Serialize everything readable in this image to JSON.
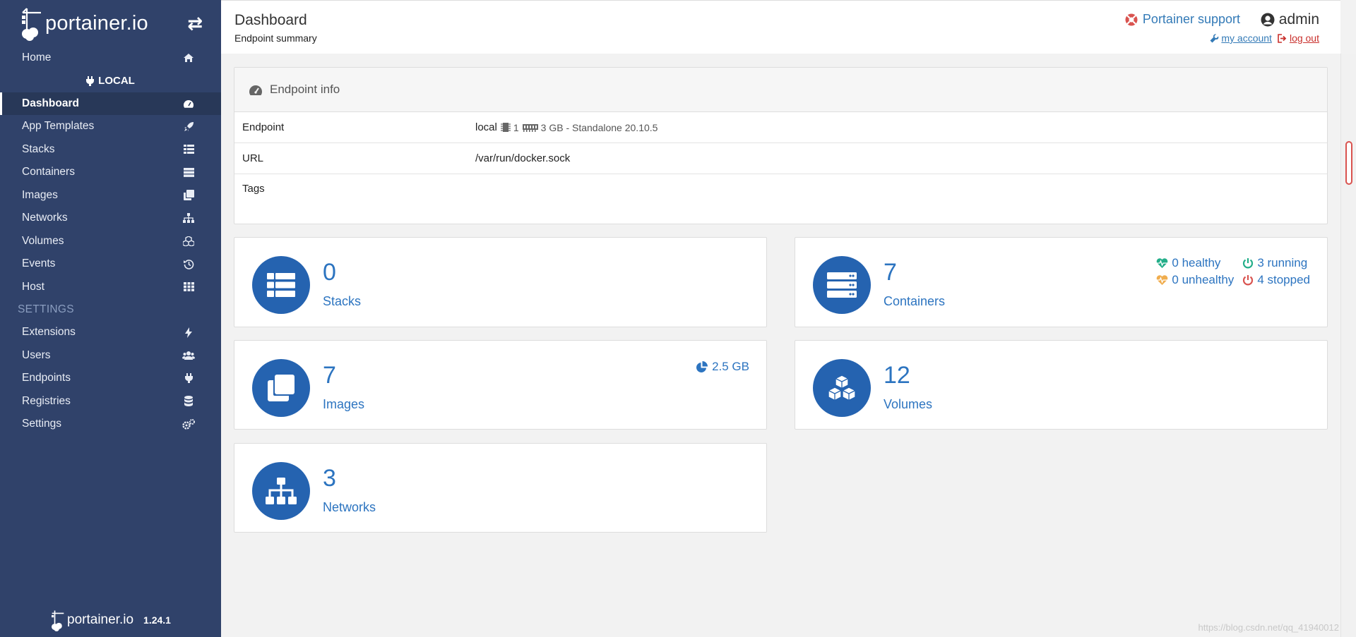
{
  "brand": {
    "logo_text": "portainer.io",
    "version": "1.24.1"
  },
  "sidebar": {
    "home": "Home",
    "endpoint_name": "LOCAL",
    "items": [
      {
        "label": "Dashboard",
        "icon": "dashboard-icon"
      },
      {
        "label": "App Templates",
        "icon": "rocket-icon"
      },
      {
        "label": "Stacks",
        "icon": "list-icon"
      },
      {
        "label": "Containers",
        "icon": "server-icon"
      },
      {
        "label": "Images",
        "icon": "clone-icon"
      },
      {
        "label": "Networks",
        "icon": "sitemap-icon"
      },
      {
        "label": "Volumes",
        "icon": "cubes-icon"
      },
      {
        "label": "Events",
        "icon": "history-icon"
      },
      {
        "label": "Host",
        "icon": "th-icon"
      }
    ],
    "settings_heading": "SETTINGS",
    "settings_items": [
      {
        "label": "Extensions",
        "icon": "bolt-icon"
      },
      {
        "label": "Users",
        "icon": "users-icon"
      },
      {
        "label": "Endpoints",
        "icon": "plug-icon"
      },
      {
        "label": "Registries",
        "icon": "database-icon"
      },
      {
        "label": "Settings",
        "icon": "cogs-icon"
      }
    ]
  },
  "header": {
    "title": "Dashboard",
    "subtitle": "Endpoint summary",
    "support": "Portainer support",
    "user": "admin",
    "my_account": "my account",
    "log_out": "log out"
  },
  "endpoint_info": {
    "heading": "Endpoint info",
    "rows": {
      "endpoint": {
        "key": "Endpoint",
        "name": "local",
        "cpu": "1",
        "details": "3 GB - Standalone 20.10.5"
      },
      "url": {
        "key": "URL",
        "value": "/var/run/docker.sock"
      },
      "tags": {
        "key": "Tags",
        "value": ""
      }
    }
  },
  "widgets": {
    "stacks": {
      "count": "0",
      "label": "Stacks"
    },
    "containers": {
      "count": "7",
      "label": "Containers",
      "healthy": "0 healthy",
      "running": "3 running",
      "unhealthy": "0 unhealthy",
      "stopped": "4 stopped"
    },
    "images": {
      "count": "7",
      "label": "Images",
      "size": "2.5 GB"
    },
    "volumes": {
      "count": "12",
      "label": "Volumes"
    },
    "networks": {
      "count": "3",
      "label": "Networks"
    }
  },
  "colors": {
    "sidebar": "#30426a",
    "accent": "#2c74c0",
    "circle": "#2563b0",
    "healthy": "#23ae89",
    "unhealthy": "#f0ad4e",
    "stopped": "#d9534f"
  },
  "watermark": "https://blog.csdn.net/qq_41940012"
}
